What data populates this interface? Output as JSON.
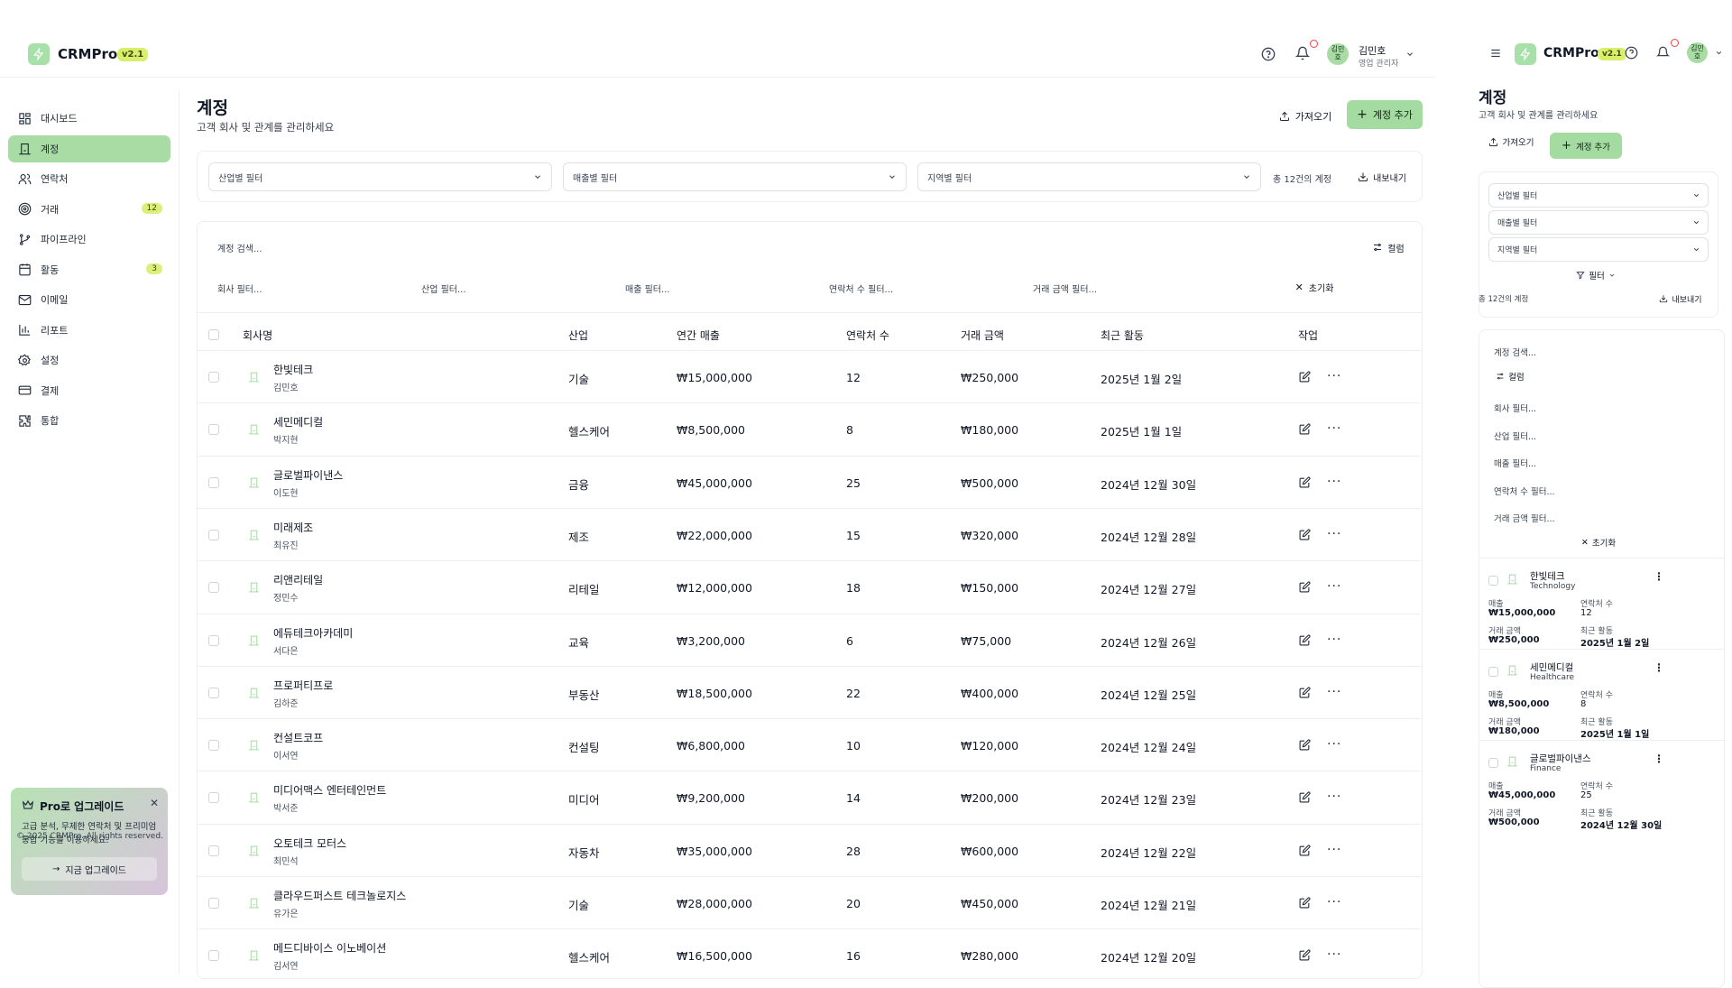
{
  "app": {
    "name": "CRMPro",
    "version": "v2.1"
  },
  "user": {
    "avatar_text": "김민\n호",
    "name": "김민호",
    "role": "영업 관리자"
  },
  "colors": {
    "accent": "#a4dba1",
    "badge": "#dcef79",
    "notify_dot": "#ef4444"
  },
  "sidebar": {
    "items": [
      {
        "label": "대시보드",
        "icon": "dashboard-icon"
      },
      {
        "label": "계정",
        "icon": "building-icon",
        "active": true
      },
      {
        "label": "연락처",
        "icon": "users-icon"
      },
      {
        "label": "거래",
        "icon": "target-icon",
        "badge": "12"
      },
      {
        "label": "파이프라인",
        "icon": "git-branch-icon"
      },
      {
        "label": "활동",
        "icon": "calendar-icon",
        "badge": "3"
      },
      {
        "label": "이메일",
        "icon": "mail-icon"
      },
      {
        "label": "리포트",
        "icon": "bar-chart-icon"
      },
      {
        "label": "설정",
        "icon": "gear-icon"
      },
      {
        "label": "결제",
        "icon": "credit-card-icon"
      },
      {
        "label": "통합",
        "icon": "puzzle-icon"
      }
    ],
    "promo": {
      "title": "Pro로 업그레이드",
      "text": "고급 분석, 무제한 연락처 및 프리미엄 통합 기능을 이용하세요.",
      "button": "지금 업그레이드"
    },
    "copyright": "© 2025 CRMPro. All rights reserved."
  },
  "page": {
    "title": "계정",
    "subtitle": "고객 회사 및 관계를 관리하세요",
    "import_label": "가져오기",
    "add_label": "계정 추가"
  },
  "filters": {
    "industry": "산업별 필터",
    "revenue": "매출별 필터",
    "region": "지역별 필터",
    "total": "총 12건의 계정",
    "export": "내보내기",
    "filter_label": "필터"
  },
  "table": {
    "search_placeholder": "계정 검색...",
    "columns_label": "컬럼",
    "column_filters": [
      "회사 필터...",
      "산업 필터...",
      "매출 필터...",
      "연락처 수 필터...",
      "거래 금액 필터..."
    ],
    "reset_label": "초기화",
    "headers": [
      "회사명",
      "산업",
      "연간 매출",
      "연락처 수",
      "거래 금액",
      "최근 활동",
      "작업"
    ],
    "rows": [
      {
        "name": "한빛테크",
        "contact": "김민호",
        "industry": "기술",
        "revenue": "₩15,000,000",
        "contacts": "12",
        "deal": "₩250,000",
        "activity": "2025년 1월 2일"
      },
      {
        "name": "세민메디컬",
        "contact": "박지현",
        "industry": "헬스케어",
        "revenue": "₩8,500,000",
        "contacts": "8",
        "deal": "₩180,000",
        "activity": "2025년 1월 1일"
      },
      {
        "name": "글로벌파이낸스",
        "contact": "이도현",
        "industry": "금융",
        "revenue": "₩45,000,000",
        "contacts": "25",
        "deal": "₩500,000",
        "activity": "2024년 12월 30일"
      },
      {
        "name": "미래제조",
        "contact": "최유진",
        "industry": "제조",
        "revenue": "₩22,000,000",
        "contacts": "15",
        "deal": "₩320,000",
        "activity": "2024년 12월 28일"
      },
      {
        "name": "리앤리테일",
        "contact": "정민수",
        "industry": "리테일",
        "revenue": "₩12,000,000",
        "contacts": "18",
        "deal": "₩150,000",
        "activity": "2024년 12월 27일"
      },
      {
        "name": "에듀테크아카데미",
        "contact": "서다은",
        "industry": "교육",
        "revenue": "₩3,200,000",
        "contacts": "6",
        "deal": "₩75,000",
        "activity": "2024년 12월 26일"
      },
      {
        "name": "프로퍼티프로",
        "contact": "김하준",
        "industry": "부동산",
        "revenue": "₩18,500,000",
        "contacts": "22",
        "deal": "₩400,000",
        "activity": "2024년 12월 25일"
      },
      {
        "name": "컨설트코프",
        "contact": "이서연",
        "industry": "컨설팅",
        "revenue": "₩6,800,000",
        "contacts": "10",
        "deal": "₩120,000",
        "activity": "2024년 12월 24일"
      },
      {
        "name": "미디어맥스 엔터테인먼트",
        "contact": "박서준",
        "industry": "미디어",
        "revenue": "₩9,200,000",
        "contacts": "14",
        "deal": "₩200,000",
        "activity": "2024년 12월 23일"
      },
      {
        "name": "오토테크 모터스",
        "contact": "최민석",
        "industry": "자동차",
        "revenue": "₩35,000,000",
        "contacts": "28",
        "deal": "₩600,000",
        "activity": "2024년 12월 22일"
      },
      {
        "name": "클라우드퍼스트 테크놀로지스",
        "contact": "유가은",
        "industry": "기술",
        "revenue": "₩28,000,000",
        "contacts": "20",
        "deal": "₩450,000",
        "activity": "2024년 12월 21일"
      },
      {
        "name": "메드디바이스 이노베이션",
        "contact": "김서연",
        "industry": "헬스케어",
        "revenue": "₩16,500,000",
        "contacts": "16",
        "deal": "₩280,000",
        "activity": "2024년 12월 20일"
      }
    ]
  },
  "mobile": {
    "labels": {
      "revenue": "매출",
      "contacts": "연락처 수",
      "deal": "거래 금액",
      "activity": "최근 활동"
    },
    "cards": [
      {
        "name": "한빛테크",
        "industry": "Technology",
        "revenue": "₩15,000,000",
        "contacts": "12",
        "deal": "₩250,000",
        "activity": "2025년 1월 2일"
      },
      {
        "name": "세민메디컬",
        "industry": "Healthcare",
        "revenue": "₩8,500,000",
        "contacts": "8",
        "deal": "₩180,000",
        "activity": "2025년 1월 1일"
      },
      {
        "name": "글로벌파이낸스",
        "industry": "Finance",
        "revenue": "₩45,000,000",
        "contacts": "25",
        "deal": "₩500,000",
        "activity": "2024년 12월 30일"
      }
    ]
  }
}
